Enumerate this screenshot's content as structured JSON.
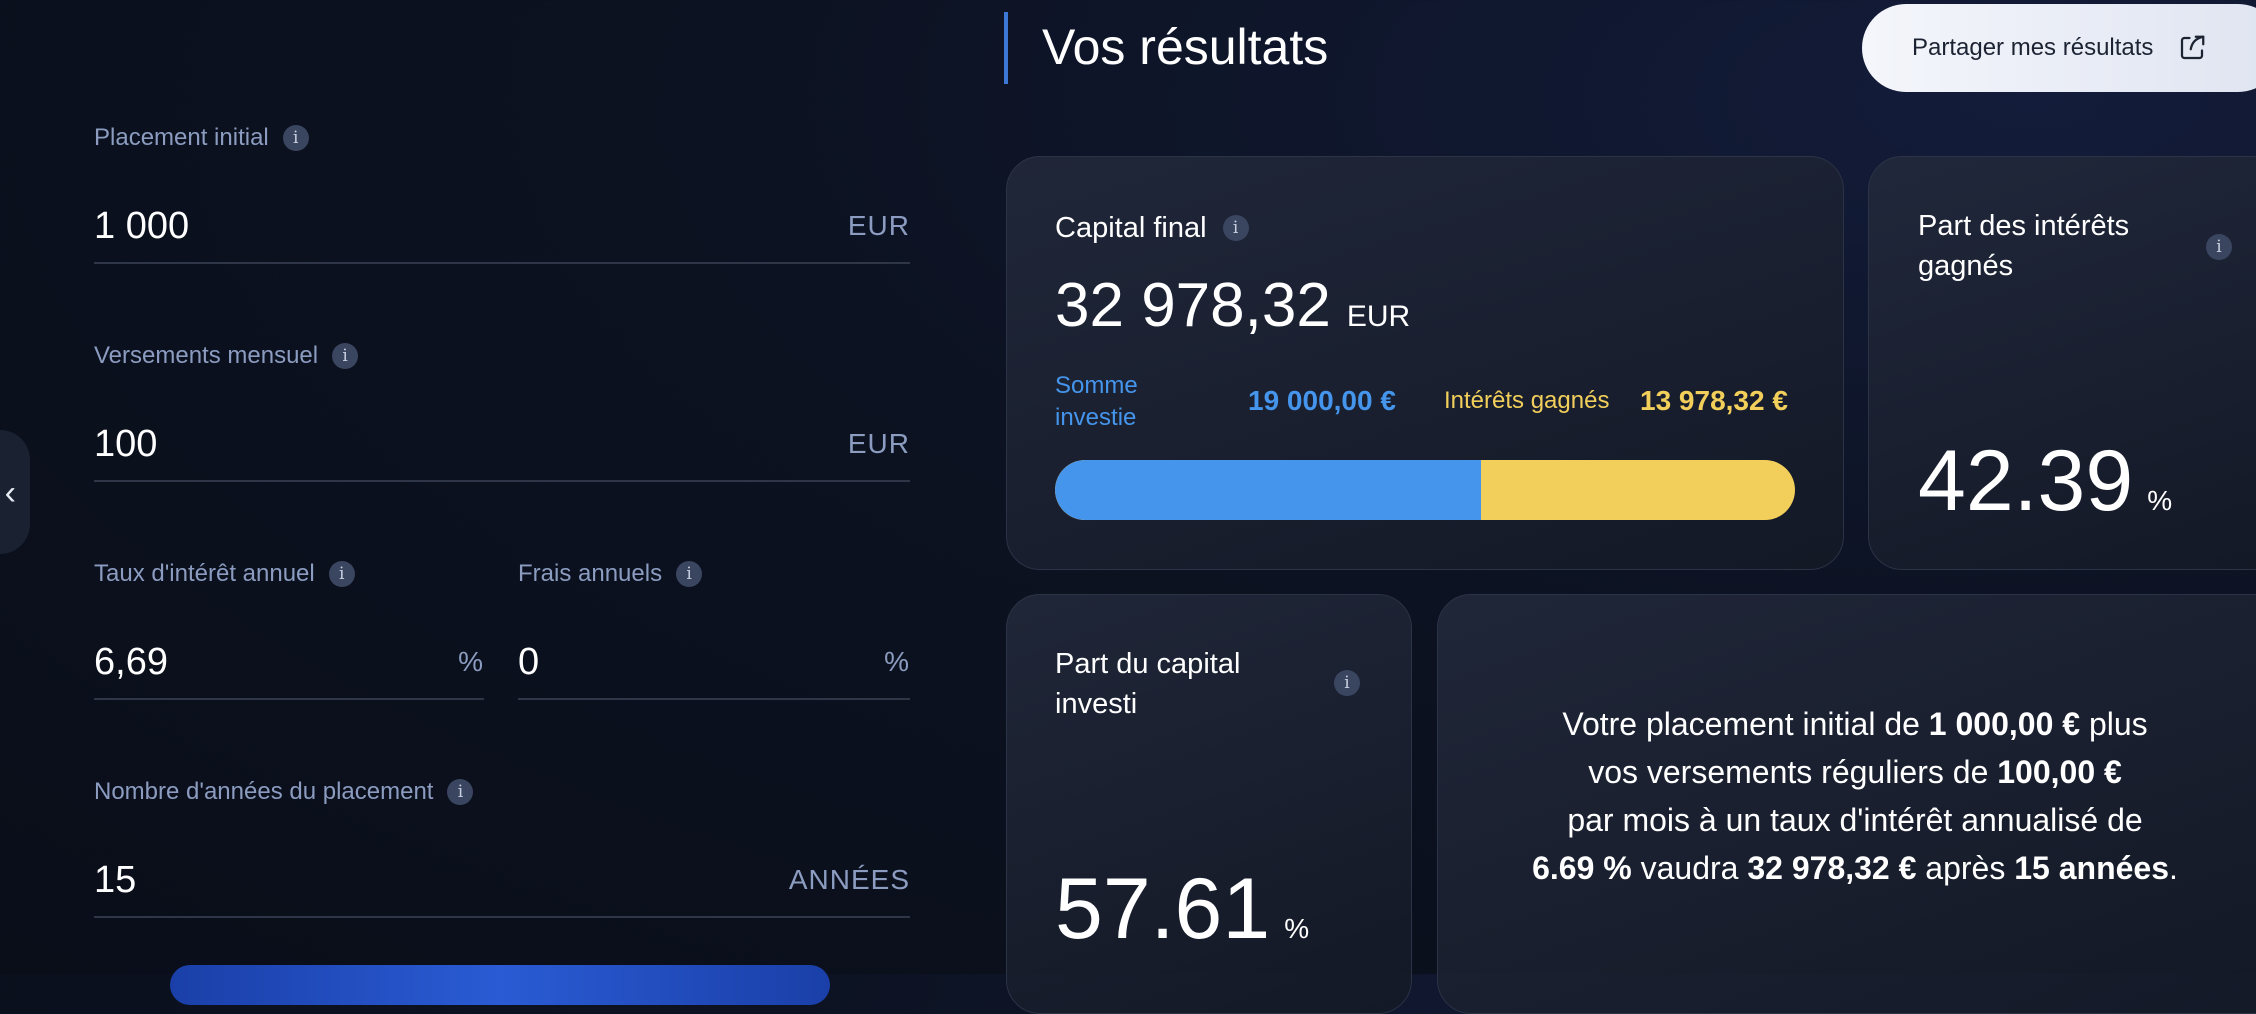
{
  "form": {
    "initial": {
      "label": "Placement initial",
      "value": "1 000",
      "unit": "EUR"
    },
    "monthly": {
      "label": "Versements mensuel",
      "value": "100",
      "unit": "EUR"
    },
    "rate": {
      "label": "Taux d'intérêt annuel",
      "value": "6,69",
      "unit": "%"
    },
    "fees": {
      "label": "Frais annuels",
      "value": "0",
      "unit": "%"
    },
    "years": {
      "label": "Nombre d'années du placement",
      "value": "15",
      "unit": "ANNÉES"
    }
  },
  "results": {
    "title": "Vos résultats",
    "share_label": "Partager mes résultats",
    "capital_final": {
      "title": "Capital final",
      "amount": "32 978,32",
      "currency": "EUR",
      "invested_label_1": "Somme",
      "invested_label_2": "investie",
      "invested_value": "19 000,00 €",
      "interest_label": "Intérêts gagnés",
      "interest_value": "13 978,32 €",
      "invested_share": 0.5761,
      "colors": {
        "invested": "#4595ec",
        "interest": "#f2cf5b"
      }
    },
    "interest_share": {
      "title_1": "Part des intérêts",
      "title_2": "gagnés",
      "value": "42.39",
      "unit": "%"
    },
    "capital_share": {
      "title_1": "Part du capital",
      "title_2": "investi",
      "value": "57.61",
      "unit": "%"
    },
    "summary": {
      "t1": "Votre placement initial de ",
      "b1": "1 000,00 €",
      "t2": " plus",
      "t3": "vos versements réguliers de ",
      "b2": "100,00 €",
      "t4": "par mois à un taux d'intérêt annualisé de",
      "b3": "6.69 %",
      "t5": " vaudra ",
      "b4": "32 978,32 €",
      "t6": " après ",
      "b5": "15 années",
      "t7": "."
    }
  }
}
